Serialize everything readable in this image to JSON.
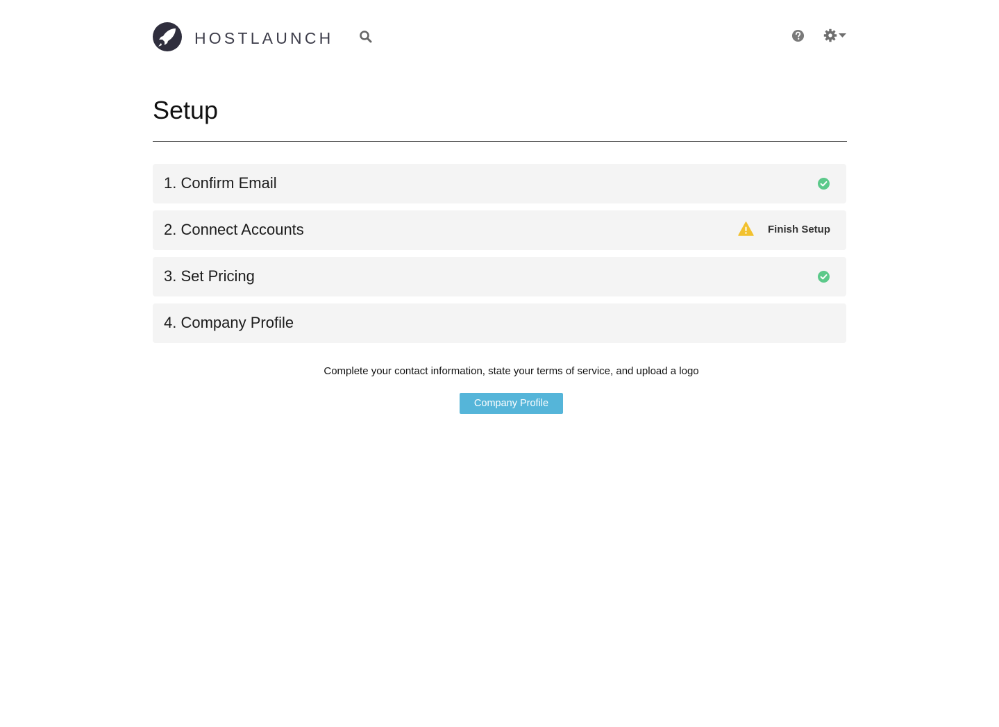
{
  "header": {
    "brand": "HOSTLAUNCH",
    "logo_icon": "rocket-icon",
    "search_icon": "search-icon",
    "help_icon": "question-circle-icon",
    "settings_icon": "gear-icon",
    "dropdown_icon": "caret-down-icon"
  },
  "page": {
    "title": "Setup"
  },
  "steps": [
    {
      "label": "1. Confirm Email",
      "status": "complete",
      "status_icon": "check-circle-icon"
    },
    {
      "label": "2. Connect Accounts",
      "status": "incomplete",
      "status_icon": "warning-icon",
      "action_label": "Finish Setup"
    },
    {
      "label": "3. Set Pricing",
      "status": "complete",
      "status_icon": "check-circle-icon"
    },
    {
      "label": "4. Company Profile",
      "status": "open"
    }
  ],
  "company_profile": {
    "description": "Complete your contact information, state your terms of service, and upload a logo",
    "button_label": "Company Profile"
  },
  "colors": {
    "accent": "#55b5d9",
    "success": "#5cc98a",
    "warning": "#f2c12e",
    "step_background": "#f4f4f4",
    "logo": "#2f2e3d"
  }
}
